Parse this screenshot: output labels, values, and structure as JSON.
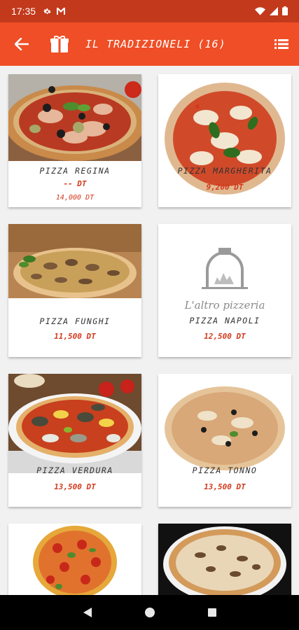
{
  "status": {
    "time": "17:35",
    "icons": [
      "gear-icon",
      "gmail-icon",
      "wifi-icon",
      "signal-icon",
      "battery-icon"
    ]
  },
  "app_bar": {
    "title": "IL TRADIZIONELI (16)",
    "back_icon": "arrow-left-icon",
    "category_icon": "box-icon",
    "view_icon": "list-view-icon"
  },
  "colors": {
    "status_bar": "#c2391c",
    "app_bar": "#ef4e26",
    "price": "#d33a1e"
  },
  "products": [
    {
      "name": "PIZZA REGINA",
      "price": "-- DT",
      "old_price": "14,000 DT"
    },
    {
      "name": "PIZZA MARGHERITA",
      "price": "9,200 DT"
    },
    {
      "name": "PIZZA FUNGHI",
      "price": "11,500 DT"
    },
    {
      "name": "PIZZA NAPOLI",
      "price": "12,500 DT",
      "placeholder_logo": "L'altro pizzeria"
    },
    {
      "name": "PIZZA VERDURA",
      "price": "13,500 DT"
    },
    {
      "name": "PIZZA TONNO",
      "price": "13,500 DT"
    },
    {
      "name": "",
      "price": ""
    },
    {
      "name": "",
      "price": ""
    }
  ]
}
